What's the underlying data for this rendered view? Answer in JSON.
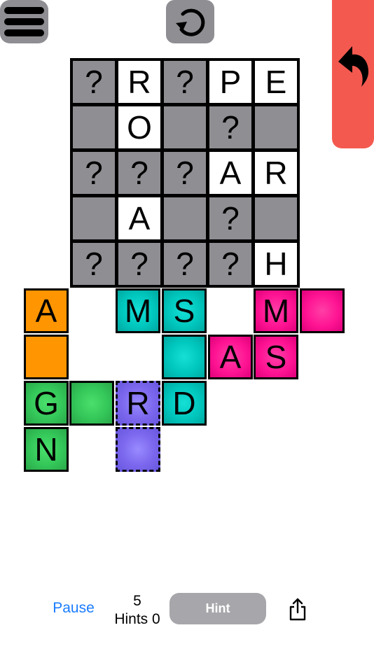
{
  "controls": {
    "menu_icon": "hamburger-menu-icon",
    "reset_icon": "restart-circle-arrow-icon",
    "undo_icon": "undo-arrow-icon",
    "undo_color": "#f4594f",
    "button_gray": "#8e8e93"
  },
  "board": {
    "rows": [
      [
        {
          "letter": "?",
          "state": "gray"
        },
        {
          "letter": "R",
          "state": "white"
        },
        {
          "letter": "?",
          "state": "gray"
        },
        {
          "letter": "P",
          "state": "white"
        },
        {
          "letter": "E",
          "state": "white"
        }
      ],
      [
        {
          "letter": "",
          "state": "gray"
        },
        {
          "letter": "O",
          "state": "white"
        },
        {
          "letter": "",
          "state": "gray"
        },
        {
          "letter": "?",
          "state": "gray"
        },
        {
          "letter": "",
          "state": "gray"
        }
      ],
      [
        {
          "letter": "?",
          "state": "gray"
        },
        {
          "letter": "?",
          "state": "gray"
        },
        {
          "letter": "?",
          "state": "gray"
        },
        {
          "letter": "A",
          "state": "white"
        },
        {
          "letter": "R",
          "state": "white"
        }
      ],
      [
        {
          "letter": "",
          "state": "gray"
        },
        {
          "letter": "A",
          "state": "white"
        },
        {
          "letter": "",
          "state": "gray"
        },
        {
          "letter": "?",
          "state": "gray"
        },
        {
          "letter": "",
          "state": "gray"
        }
      ],
      [
        {
          "letter": "?",
          "state": "gray"
        },
        {
          "letter": "?",
          "state": "gray"
        },
        {
          "letter": "?",
          "state": "gray"
        },
        {
          "letter": "?",
          "state": "gray"
        },
        {
          "letter": "H",
          "state": "white"
        }
      ]
    ]
  },
  "pieces": {
    "orange": {
      "color": "#ff9500",
      "tiles": [
        "A",
        ""
      ]
    },
    "teal": {
      "color": "#00c7be",
      "tiles": [
        "M",
        "S",
        "",
        "D"
      ]
    },
    "pink": {
      "color": "#ff1493",
      "tiles": [
        "M",
        "",
        "A",
        "S"
      ]
    },
    "green": {
      "color": "#34c759",
      "tiles": [
        "G",
        "",
        "N"
      ]
    },
    "purple": {
      "color": "#7b68ee",
      "tiles": [
        "R",
        ""
      ],
      "selected": true
    }
  },
  "footer": {
    "pause_label": "Pause",
    "count_value": "5",
    "hints_label": "Hints 0",
    "hint_button_label": "Hint",
    "share_icon": "share-icon",
    "pause_color": "#1a7cff"
  }
}
